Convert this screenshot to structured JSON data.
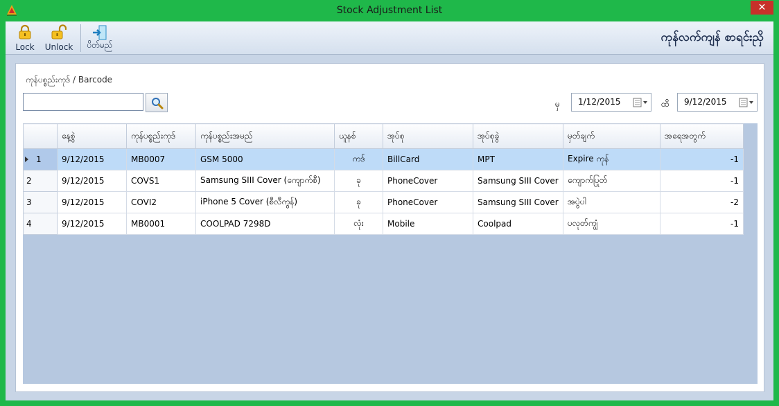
{
  "window": {
    "title": "Stock Adjustment List",
    "close_glyph": "✕"
  },
  "toolbar": {
    "lock_label": "Lock",
    "unlock_label": "Unlock",
    "exit_label": "ပိတ်မည်",
    "heading": "ကုန်လက်ကျန် စာရင်းညှိ"
  },
  "search": {
    "label": "ကုန်ပစ္စည်းကုဒ် / Barcode",
    "value": "",
    "placeholder": ""
  },
  "date_filter": {
    "from_label": "မှ",
    "from_value": "1/12/2015",
    "to_label": "ထိ",
    "to_value": "9/12/2015"
  },
  "table": {
    "columns": [
      "နေ့စွဲ",
      "ကုန်ပစ္စည်းကုဒ်",
      "ကုန်ပစ္စည်းအမည်",
      "ယူနစ်",
      "အုပ်စု",
      "အုပ်စုခွဲ",
      "မှတ်ချက်",
      "အရေအတွက်"
    ],
    "rows": [
      {
        "no": "1",
        "date": "9/12/2015",
        "code": "MB0007",
        "name": "GSM 5000",
        "unit": "ကဒ်",
        "group": "BillCard",
        "subgroup": "MPT",
        "remark": "Expire ကုန်",
        "qty": "-1"
      },
      {
        "no": "2",
        "date": "9/12/2015",
        "code": "COVS1",
        "name": "Samsung SIII Cover (ကျောက်စီ)",
        "unit": "ခု",
        "group": "PhoneCover",
        "subgroup": "Samsung SIII Cover",
        "remark": "ကျောက်ပြုတ်",
        "qty": "-1"
      },
      {
        "no": "3",
        "date": "9/12/2015",
        "code": "COVI2",
        "name": "iPhone 5 Cover (စီလီကွန်)",
        "unit": "ခု",
        "group": "PhoneCover",
        "subgroup": "Samsung SIII Cover",
        "remark": "အပွဲပါ",
        "qty": "-2"
      },
      {
        "no": "4",
        "date": "9/12/2015",
        "code": "MB0001",
        "name": "COOLPAD 7298D",
        "unit": "လုံး",
        "group": "Mobile",
        "subgroup": "Coolpad",
        "remark": "ပလုတ်ကျွံ",
        "qty": "-1"
      }
    ],
    "selected_row": 0
  }
}
